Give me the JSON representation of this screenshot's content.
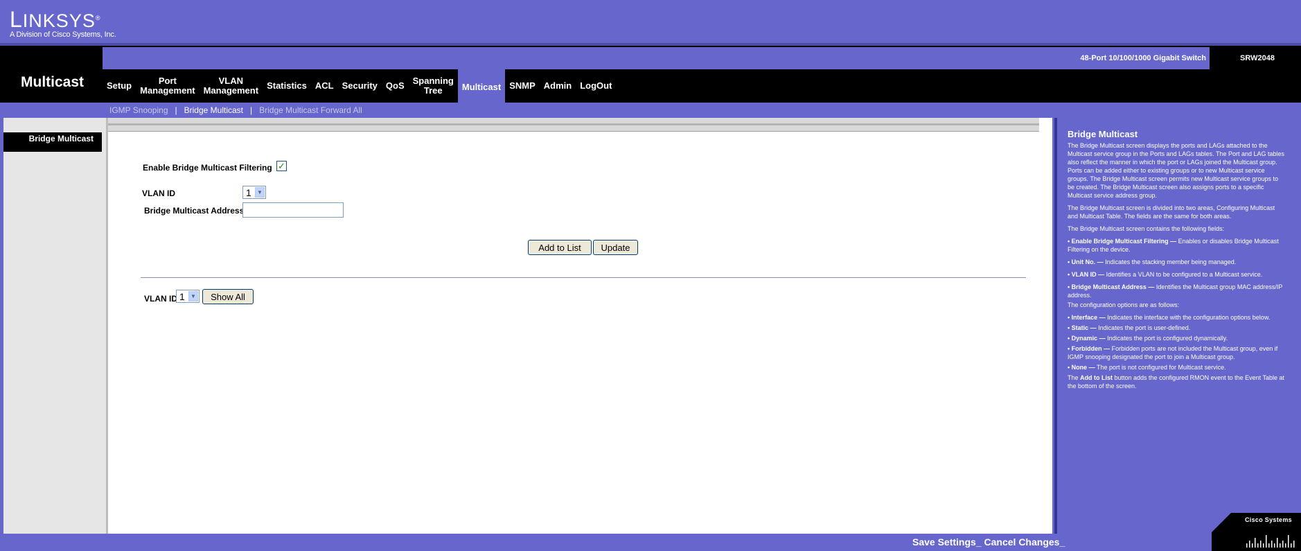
{
  "header": {
    "brand_first": "L",
    "brand_rest": "INKSYS",
    "brand_mark": "®",
    "division": "A Division of Cisco Systems, Inc."
  },
  "section_title": "Multicast",
  "model": {
    "description": "48-Port 10/100/1000 Gigabit Switch",
    "number": "SRW2048"
  },
  "nav": {
    "tabs": [
      {
        "label": "Setup"
      },
      {
        "label": "Port\nManagement"
      },
      {
        "label": "VLAN\nManagement"
      },
      {
        "label": "Statistics"
      },
      {
        "label": "ACL"
      },
      {
        "label": "Security"
      },
      {
        "label": "QoS"
      },
      {
        "label": "Spanning\nTree"
      },
      {
        "label": "Multicast",
        "active": true
      },
      {
        "label": "SNMP"
      },
      {
        "label": "Admin"
      },
      {
        "label": "LogOut"
      }
    ]
  },
  "subnav": {
    "items": [
      "IGMP Snooping",
      "Bridge Multicast",
      "Bridge Multicast Forward All"
    ],
    "separator": "|"
  },
  "sidebar": {
    "item": "Bridge Multicast"
  },
  "form": {
    "enable_label": "Enable Bridge Multicast Filtering",
    "enable_checked": true,
    "check_glyph": "✓",
    "vlan_label": "VLAN ID",
    "vlan_value": "1",
    "address_label": "Bridge Multicast Address",
    "address_value": "",
    "add_button": "Add to List",
    "update_button": "Update",
    "vlan2_label": "VLAN ID",
    "vlan2_value": "1",
    "show_all_button": "Show All",
    "arrow_glyph": "▼"
  },
  "help": {
    "title": "Bridge Multicast",
    "intro": "The Bridge Multicast screen displays the ports and LAGs attached to the Multicast service group in the Ports and LAGs tables. The Port and LAG tables also reflect the manner in which the port or LAGs joined the Multicast group. Ports can be added either to existing groups or to new Multicast service groups. The Bridge Multicast screen permits new Multicast service groups to be created. The Bridge Multicast screen also assigns ports to a specific Multicast service address group.",
    "areas": "The Bridge Multicast screen is divided into two areas, Configuring Multicast and Multicast Table. The fields are the same for both areas.",
    "fields_intro": "The Bridge Multicast screen contains the following fields:",
    "fields": [
      {
        "name": "• Enable Bridge Multicast Filtering —",
        "desc": " Enables or disables Bridge Multicast Filtering on the device."
      },
      {
        "name": "• Unit No. —",
        "desc": " Indicates the stacking member being managed."
      },
      {
        "name": "• VLAN ID —",
        "desc": " Identifies a VLAN to be configured to a Multicast service."
      },
      {
        "name": "• Bridge Multicast Address —",
        "desc": " Identifies the Multicast group MAC address/IP address."
      }
    ],
    "options_intro": "The configuration options are as follows:",
    "options": [
      {
        "name": "• Interface —",
        "desc": " Indicates the interface with the configuration options below."
      },
      {
        "name": "• Static —",
        "desc": " Indicates the port is user-defined."
      },
      {
        "name": "• Dynamic —",
        "desc": " Indicates the port is configured dynamically."
      },
      {
        "name": "• Forbidden —",
        "desc": " Forbidden ports are not included the Multicast group, even if IGMP snooping designated the port to join a Multicast group."
      },
      {
        "name": "• None —",
        "desc": " The port is not configured for Multicast service."
      }
    ],
    "footer_pre": "The ",
    "footer_bold": "Add to List",
    "footer_post": " button adds the configured RMON event to the Event Table at the bottom of the screen."
  },
  "bottom": {
    "save": "Save Settings",
    "cancel": "Cancel Changes"
  },
  "cisco": {
    "label": "Cisco Systems"
  },
  "colors": {
    "brand_purple": "#6666cc",
    "black_band": "#000000"
  }
}
